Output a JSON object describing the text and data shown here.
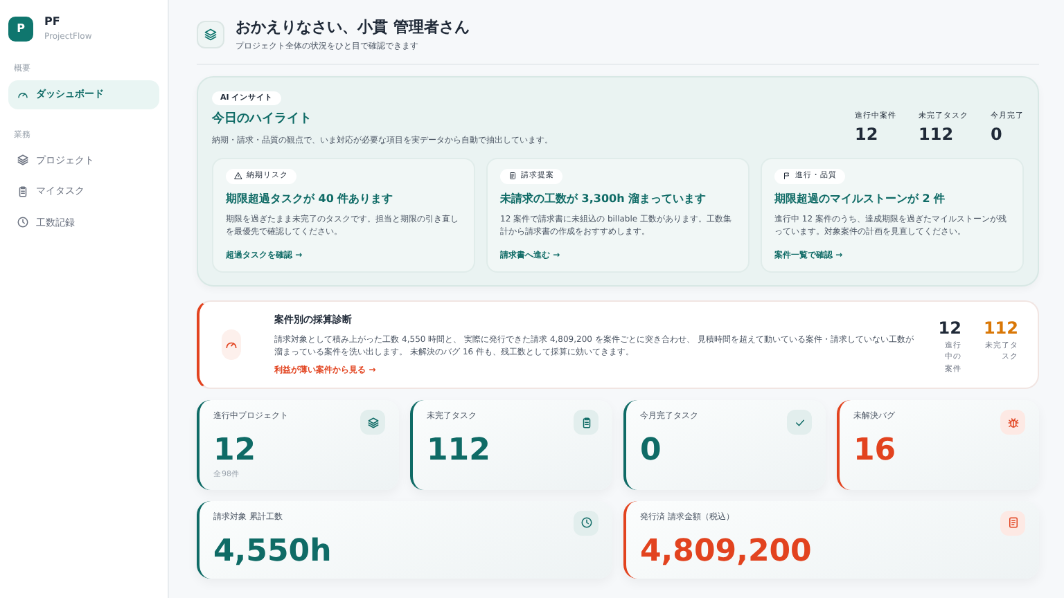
{
  "brand": {
    "logo": "P",
    "name": "PF",
    "subtitle": "ProjectFlow"
  },
  "sidebar": {
    "sections": [
      {
        "title": "概要",
        "items": [
          {
            "label": "ダッシュボード",
            "selected": true
          }
        ]
      },
      {
        "title": "業務",
        "items": [
          {
            "label": "プロジェクト",
            "selected": false
          },
          {
            "label": "マイタスク",
            "selected": false
          },
          {
            "label": "工数記録",
            "selected": false
          }
        ]
      }
    ]
  },
  "header": {
    "title": "おかえりなさい、小貫 管理者さん",
    "subtitle": "プロジェクト全体の状況をひと目で確認できます"
  },
  "highlight": {
    "badge": "AI インサイト",
    "title": "今日のハイライト",
    "description": "納期・請求・品質の観点で、いま対応が必要な項目を実データから自動で抽出しています。",
    "stats": [
      {
        "label": "進行中案件",
        "value": "12"
      },
      {
        "label": "未完了タスク",
        "value": "112"
      },
      {
        "label": "今月完了",
        "value": "0"
      }
    ],
    "cards": [
      {
        "tag": "納期リスク",
        "title": "期限超過タスクが 40 件あります",
        "text": "期限を過ぎたまま未完了のタスクです。担当と期限の引き直しを最優先で確認してください。",
        "link": "超過タスクを確認 →"
      },
      {
        "tag": "請求提案",
        "title": "未請求の工数が 3,300h 溜まっています",
        "text": "12 案件で請求書に未組込の billable 工数があります。工数集計から請求書の作成をおすすめします。",
        "link": "請求書へ進む →"
      },
      {
        "tag": "進行・品質",
        "title": "期限超過のマイルストーンが 2 件",
        "text": "進行中 12 案件のうち、達成期限を過ぎたマイルストーンが残っています。対象案件の計画を見直してください。",
        "link": "案件一覧で確認 →"
      }
    ]
  },
  "diagnosis": {
    "title": "案件別の採算診断",
    "text": "請求対象として積み上がった工数 4,550 時間と、 実際に発行できた請求 4,809,200 を案件ごとに突き合わせ、 見積時間を超えて動いている案件・請求していない工数が溜まっている案件を洗い出します。 未解決のバグ 16 件も、残工数として採算に効いてきます。",
    "link": "利益が薄い案件から見る →",
    "stats": [
      {
        "value": "12",
        "label": "進行中の案件",
        "color": "#1f2937"
      },
      {
        "value": "112",
        "label": "未完了タスク",
        "color": "#d97706"
      }
    ]
  },
  "kpis": [
    {
      "label": "進行中プロジェクト",
      "value": "12",
      "note": "全98件",
      "color": "#0f6b66"
    },
    {
      "label": "未完了タスク",
      "value": "112",
      "color": "#0f6b66"
    },
    {
      "label": "今月完了タスク",
      "value": "0",
      "color": "#0f6b66"
    },
    {
      "label": "未解決バグ",
      "value": "16",
      "color": "#e2431f"
    }
  ],
  "totals": [
    {
      "label": "請求対象 累計工数",
      "value": "4,550h",
      "color": "#0f6b66"
    },
    {
      "label": "発行済 請求金額（税込）",
      "value": "4,809,200",
      "color": "#e2431f"
    }
  ]
}
